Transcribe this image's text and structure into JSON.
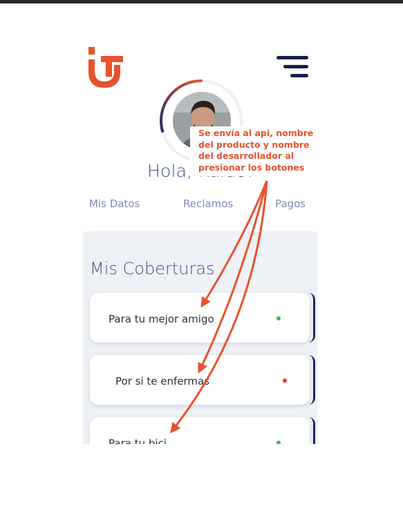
{
  "app": {
    "greeting": "Hola, Kaldo!"
  },
  "header": {
    "logo_icon": "brand-logo-icon",
    "menu_icon": "hamburger-menu-icon"
  },
  "nav": {
    "tabs": [
      {
        "label": "Mis Datos"
      },
      {
        "label": "Reclamos"
      },
      {
        "label": "Pagos"
      }
    ]
  },
  "coverages": {
    "title": "Mis Coberturas",
    "items": [
      {
        "label": "Para tu mejor amigo",
        "status_color": "#4caf50"
      },
      {
        "label": "Por si te enfermas",
        "status_color": "#e53935"
      },
      {
        "label": "Para tu bici",
        "status_color": "#4caf50"
      }
    ]
  },
  "annotation": {
    "text": "Se envía al api, nombre del producto y nombre del desarrollador al presionar los botones",
    "color": "#e8522d"
  },
  "colors": {
    "brand_orange": "#e8522d",
    "navy": "#14204a",
    "accent_text": "#3f5388"
  }
}
